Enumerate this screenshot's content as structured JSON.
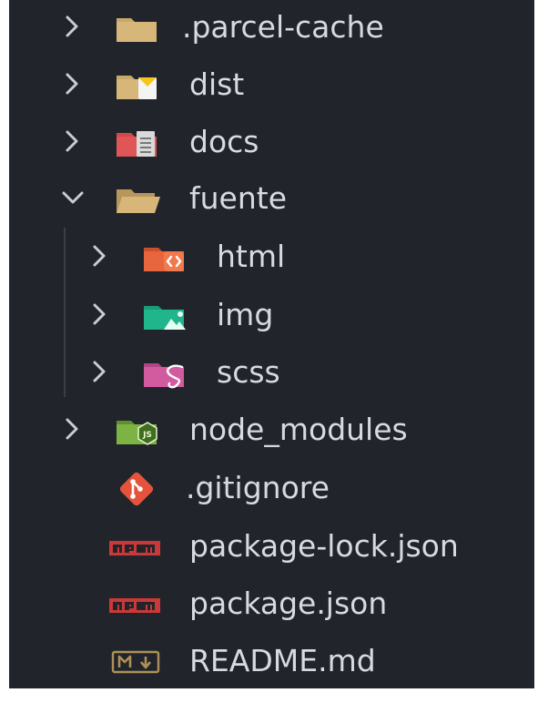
{
  "explorer": {
    "items": [
      {
        "label": ".parcel-cache",
        "icon": "folder-icon",
        "depth": 0,
        "chevron": "right"
      },
      {
        "label": "dist",
        "icon": "folder-dist-icon",
        "depth": 0,
        "chevron": "right"
      },
      {
        "label": "docs",
        "icon": "folder-docs-icon",
        "depth": 0,
        "chevron": "right"
      },
      {
        "label": "fuente",
        "icon": "folder-open-icon",
        "depth": 0,
        "chevron": "down"
      },
      {
        "label": "html",
        "icon": "folder-html-icon",
        "depth": 1,
        "chevron": "right"
      },
      {
        "label": "img",
        "icon": "folder-images-icon",
        "depth": 1,
        "chevron": "right"
      },
      {
        "label": "scss",
        "icon": "folder-sass-icon",
        "depth": 1,
        "chevron": "right"
      },
      {
        "label": "node_modules",
        "icon": "folder-node-icon",
        "depth": 0,
        "chevron": "right"
      },
      {
        "label": ".gitignore",
        "icon": "git-icon",
        "depth": 0,
        "chevron": "none"
      },
      {
        "label": "package-lock.json",
        "icon": "npm-icon",
        "depth": 0,
        "chevron": "none"
      },
      {
        "label": "package.json",
        "icon": "npm-icon",
        "depth": 0,
        "chevron": "none"
      },
      {
        "label": "README.md",
        "icon": "markdown-icon",
        "depth": 0,
        "chevron": "none"
      }
    ]
  },
  "colors": {
    "background": "#21252b",
    "text": "#d7dae0",
    "chevron": "#c8ccd4",
    "folder": "#c9a96a",
    "html": "#e8663d",
    "images": "#21b58b",
    "sass": "#d25ba0",
    "node": "#7cb342",
    "git": "#e5533c",
    "npm": "#cb3837",
    "docs": "#d64848"
  }
}
